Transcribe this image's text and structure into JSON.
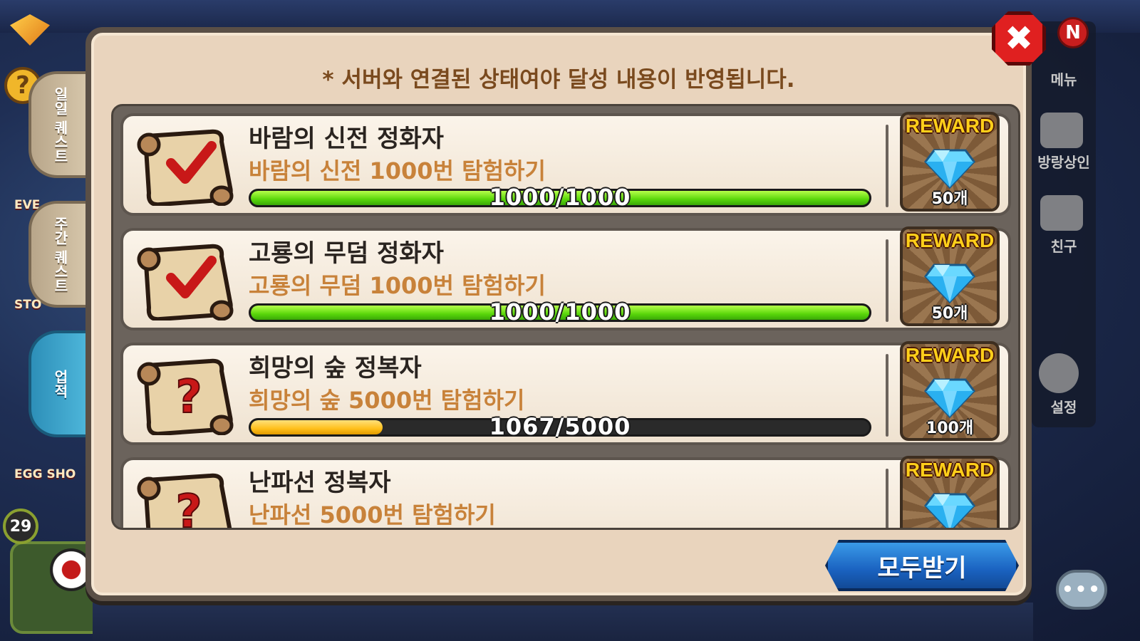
{
  "notice": "* 서버와 연결된 상태여야 달성 내용이 반영됩니다.",
  "left_tabs": [
    {
      "label": "일일 퀘스트",
      "active": false
    },
    {
      "label": "주간 퀘스트",
      "active": false
    },
    {
      "label": "업적",
      "active": true
    }
  ],
  "left_labels": [
    "EVE",
    "STO",
    "EGG SHO"
  ],
  "player_level": "29",
  "right_menu": {
    "badge": "N",
    "items": [
      "메뉴",
      "방랑상인",
      "친구",
      "설정"
    ]
  },
  "achievements": [
    {
      "title": "바람의 신전 정화자",
      "description": "바람의 신전 1000번 탐험하기",
      "progress_text": "1000/1000",
      "progress": 1.0,
      "status_icon": "checkmark-scroll-icon",
      "reward_label": "REWARD",
      "reward_icon": "diamond-icon",
      "reward_count": "50개"
    },
    {
      "title": "고룡의 무덤 정화자",
      "description": "고룡의 무덤 1000번 탐험하기",
      "progress_text": "1000/1000",
      "progress": 1.0,
      "status_icon": "checkmark-scroll-icon",
      "reward_label": "REWARD",
      "reward_icon": "diamond-icon",
      "reward_count": "50개"
    },
    {
      "title": "희망의 숲 정복자",
      "description": "희망의 숲 5000번 탐험하기",
      "progress_text": "1067/5000",
      "progress": 0.2134,
      "status_icon": "question-scroll-icon",
      "reward_label": "REWARD",
      "reward_icon": "diamond-icon",
      "reward_count": "100개"
    },
    {
      "title": "난파선 정복자",
      "description": "난파선 5000번 탐험하기",
      "progress_text": "",
      "progress": null,
      "status_icon": "question-scroll-icon",
      "reward_label": "REWARD",
      "reward_icon": "diamond-icon",
      "reward_count": ""
    }
  ],
  "claim_all_label": "모두받기",
  "close_icon": "close-icon",
  "colors": {
    "panel_bg": "#e9d4bd",
    "progress_complete": "#58d60a",
    "progress_partial": "#ffbf1a",
    "reward_text": "#ffcf1a",
    "claim_button": "#1a62c0",
    "close_button": "#e02020"
  }
}
